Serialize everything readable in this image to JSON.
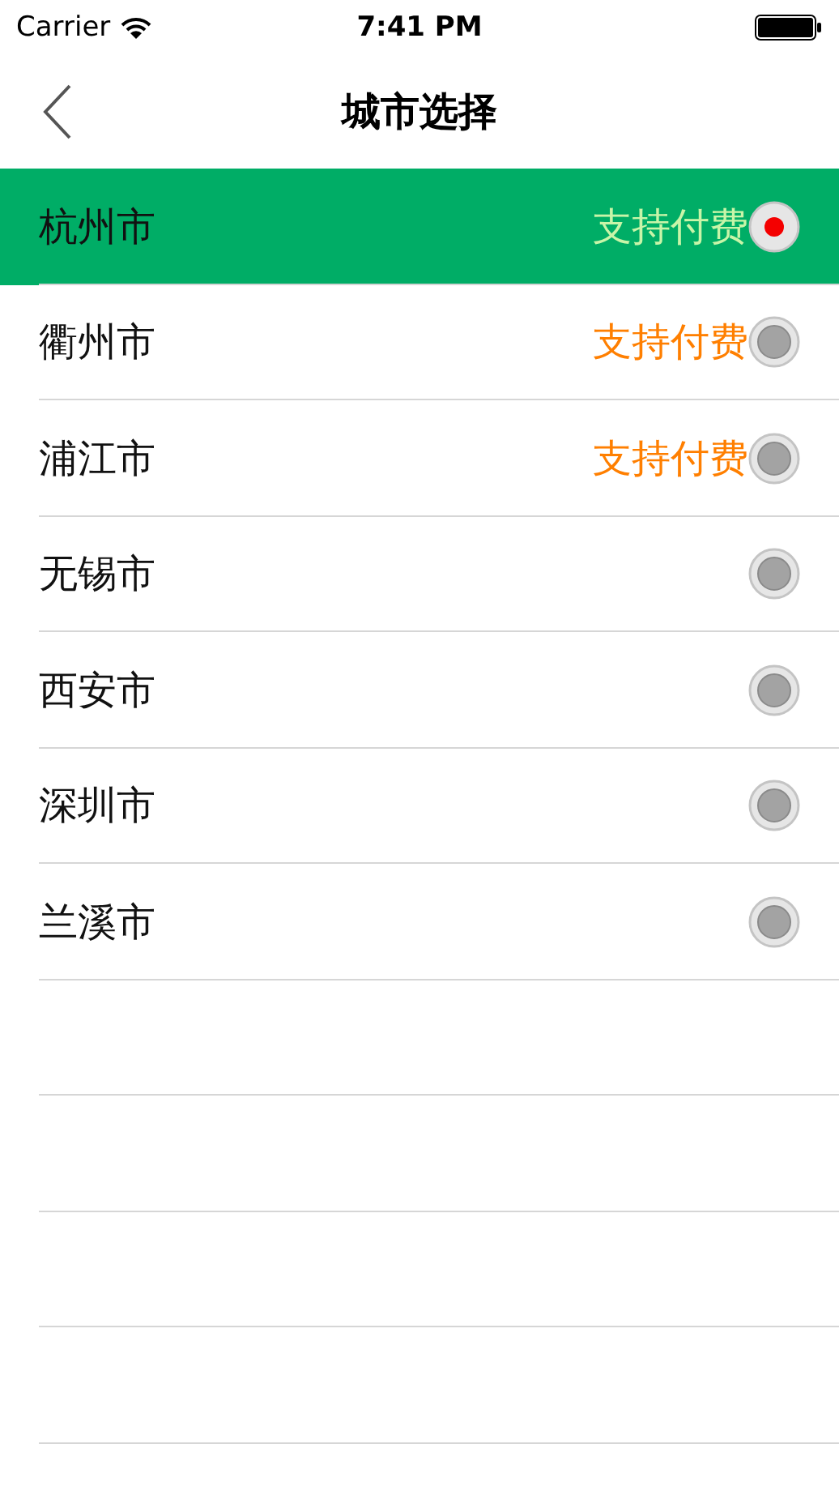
{
  "status_bar": {
    "carrier": "Carrier",
    "time": "7:41 PM"
  },
  "nav": {
    "title": "城市选择"
  },
  "cities": [
    {
      "name": "杭州市",
      "badge": "支持付费",
      "selected": true
    },
    {
      "name": "衢州市",
      "badge": "支持付费",
      "selected": false
    },
    {
      "name": "浦江市",
      "badge": "支持付费",
      "selected": false
    },
    {
      "name": "无锡市",
      "selected": false
    },
    {
      "name": "西安市",
      "selected": false
    },
    {
      "name": "深圳市",
      "selected": false
    },
    {
      "name": "兰溪市",
      "selected": false
    }
  ]
}
